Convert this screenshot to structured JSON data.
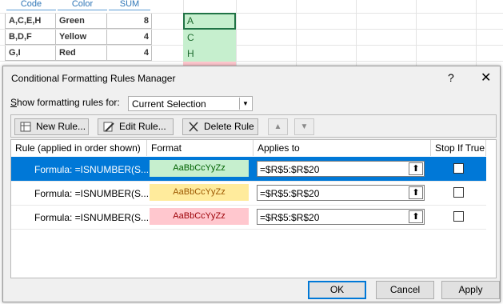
{
  "sheet": {
    "headers": [
      "Code",
      "Color",
      "SUM"
    ],
    "rows": [
      {
        "code": "A,C,E,H",
        "color": "Green",
        "sum": "8"
      },
      {
        "code": "B,D,F",
        "color": "Yellow",
        "sum": "4"
      },
      {
        "code": "G,I",
        "color": "Red",
        "sum": "4"
      }
    ],
    "highlight_cells": [
      "A",
      "C",
      "H"
    ]
  },
  "dialog": {
    "title": "Conditional Formatting Rules Manager",
    "help": "?",
    "close": "✕",
    "show_label": "Show formatting rules for:",
    "show_value": "Current Selection",
    "toolbar": {
      "new_rule": "New Rule...",
      "edit_rule": "Edit Rule...",
      "delete_rule": "Delete Rule",
      "move_up_icon": "▲",
      "move_down_icon": "▼"
    },
    "columns": [
      "Rule (applied in order shown)",
      "Format",
      "Applies to",
      "Stop If True"
    ],
    "rules": [
      {
        "formula": "Formula: =ISNUMBER(S...",
        "preview": "AaBbCcYyZz",
        "preview_bg": "#c6efce",
        "preview_color": "#006100",
        "applies": "=$R$5:$R$20"
      },
      {
        "formula": "Formula: =ISNUMBER(S...",
        "preview": "AaBbCcYyZz",
        "preview_bg": "#ffeb9c",
        "preview_color": "#9c5700",
        "applies": "=$R$5:$R$20"
      },
      {
        "formula": "Formula: =ISNUMBER(S...",
        "preview": "AaBbCcYyZz",
        "preview_bg": "#ffc7ce",
        "preview_color": "#9c0006",
        "applies": "=$R$5:$R$20"
      }
    ],
    "buttons": {
      "ok": "OK",
      "cancel": "Cancel",
      "apply": "Apply"
    }
  }
}
